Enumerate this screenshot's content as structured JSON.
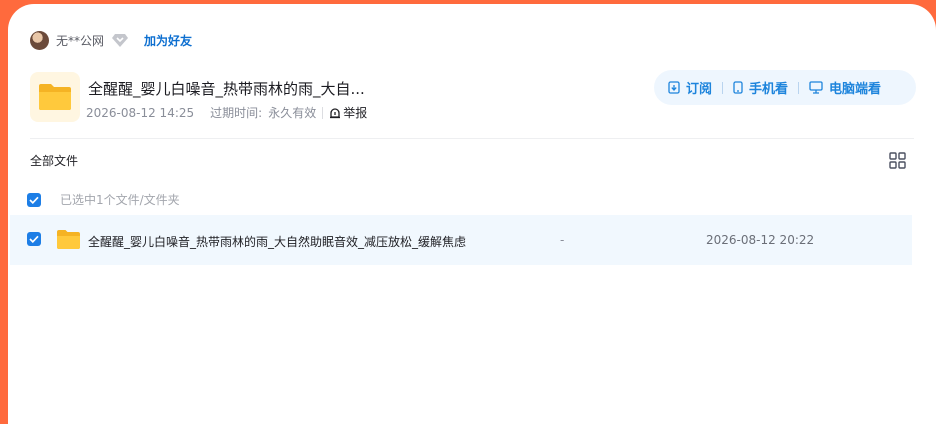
{
  "share": {
    "username": "无**公网",
    "add_friend_label": "加为好友",
    "title": "全醒醒_婴儿白噪音_热带雨林的雨_大自...",
    "created": "2026-08-12 14:25",
    "expire_label": "过期时间:",
    "expire_value": "永久有效",
    "report_label": "举报"
  },
  "actions": {
    "subscribe_label": "订阅",
    "phone_label": "手机看",
    "pc_label": "电脑端看"
  },
  "list": {
    "header_label": "全部文件",
    "selected_text": "已选中1个文件/文件夹",
    "rows": [
      {
        "name": "全醒醒_婴儿白噪音_热带雨林的雨_大自然助眠音效_减压放松_缓解焦虑",
        "size": "-",
        "date": "2026-08-12 20:22",
        "icon": "folder-icon",
        "checked": true
      }
    ]
  },
  "colors": {
    "accent": "#1d84dc",
    "brand_orange": "#ff6a3d",
    "folder_yellow": "#ffc93c",
    "row_highlight": "#f1f8fe"
  },
  "icons": [
    "diamond-icon",
    "folder-icon",
    "report-icon",
    "subscribe-icon",
    "phone-icon",
    "monitor-icon",
    "grid-view-icon",
    "check-icon"
  ]
}
